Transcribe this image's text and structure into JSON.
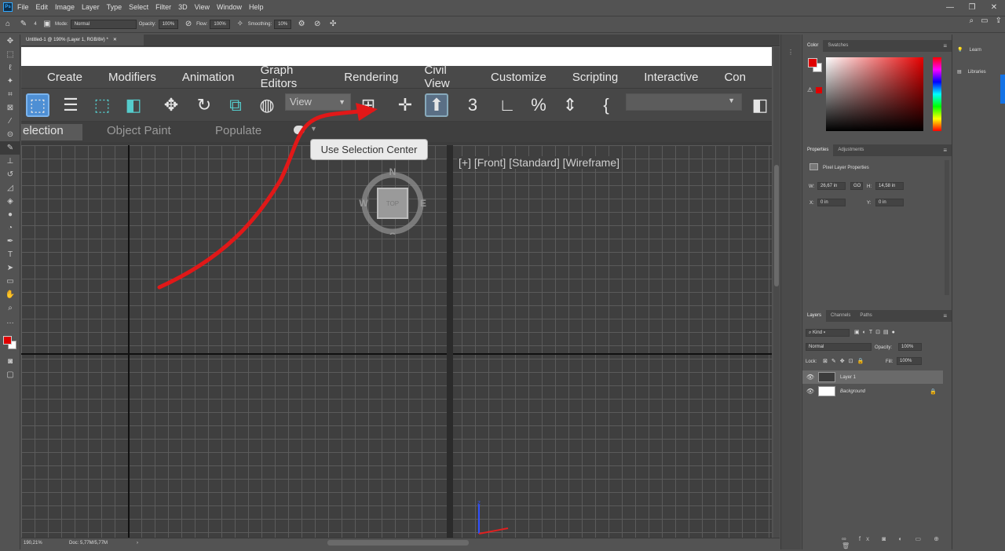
{
  "app": {
    "logo": "Ps"
  },
  "menubar": {
    "items": [
      "File",
      "Edit",
      "Image",
      "Layer",
      "Type",
      "Select",
      "Filter",
      "3D",
      "View",
      "Window",
      "Help"
    ]
  },
  "window_controls": [
    "minimize-icon",
    "maximize-icon",
    "close-icon"
  ],
  "options_bar": {
    "mode_label": "Mode:",
    "mode_value": "Normal",
    "opacity_label": "Opacity:",
    "opacity_value": "100%",
    "flow_label": "Flow:",
    "flow_value": "100%",
    "smoothing_label": "Smoothing:",
    "smoothing_value": "10%",
    "brush_size": "4"
  },
  "document": {
    "tab_title": "Untitled-1 @ 190% (Layer 1, RGB/8#) *"
  },
  "max_screenshot": {
    "menu": [
      "Create",
      "Modifiers",
      "Animation",
      "Graph Editors",
      "Rendering",
      "Civil View",
      "Customize",
      "Scripting",
      "Interactive",
      "Con"
    ],
    "view_dropdown": "View",
    "tooltip": "Use Selection Center",
    "ribbon_tabs": [
      "election",
      "Object Paint",
      "Populate"
    ],
    "viewport_label": "[+] [Front] [Standard] [Wireframe]",
    "viewcube": {
      "n": "N",
      "s": "S",
      "e": "E",
      "w": "W",
      "face": "TOP"
    },
    "axis": {
      "z": "z"
    },
    "annotation_color": "#e11818"
  },
  "status": {
    "zoom": "190,21%",
    "doc": "Doc: 5,77M/5,77M"
  },
  "color_panel": {
    "tabs": [
      "Color",
      "Swatches"
    ],
    "foreground": "#e00000",
    "background": "#ffffff"
  },
  "properties_panel": {
    "tabs": [
      "Properties",
      "Adjustments"
    ],
    "title": "Pixel Layer Properties",
    "w_label": "W:",
    "w_value": "26,67 in",
    "h_label": "H:",
    "h_value": "14,58 in",
    "x_label": "X:",
    "x_value": "0 in",
    "y_label": "Y:",
    "y_value": "0 in",
    "link_label": "GO"
  },
  "layers_panel": {
    "tabs": [
      "Layers",
      "Channels",
      "Paths"
    ],
    "filter": "Kind",
    "blend": "Normal",
    "opacity_label": "Opacity:",
    "opacity_value": "100%",
    "lock_label": "Lock:",
    "fill_label": "Fill:",
    "fill_value": "100%",
    "layers": [
      {
        "name": "Layer 1",
        "selected": true
      },
      {
        "name": "Background",
        "selected": false
      }
    ]
  },
  "far_right": {
    "items": [
      "Learn",
      "Libraries"
    ]
  }
}
